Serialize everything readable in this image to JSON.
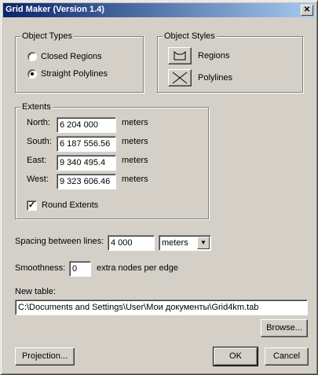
{
  "window": {
    "title": "Grid Maker (Version 1.4)",
    "close_glyph": "✕"
  },
  "object_types": {
    "legend": "Object Types",
    "options": [
      {
        "label": "Closed Regions",
        "selected": false
      },
      {
        "label": "Straight Polylines",
        "selected": true
      }
    ]
  },
  "object_styles": {
    "legend": "Object Styles",
    "regions_label": "Regions",
    "polylines_label": "Polylines"
  },
  "extents": {
    "legend": "Extents",
    "north_label": "North:",
    "north_value": "6 204 000",
    "south_label": "South:",
    "south_value": "6 187 556.56",
    "east_label": "East:",
    "east_value": "9 340 495.4",
    "west_label": "West:",
    "west_value": "9 323 606.46",
    "unit": "meters",
    "round_label": "Round Extents",
    "round_checked": true,
    "check_glyph": "✓"
  },
  "spacing": {
    "label": "Spacing between lines:",
    "value": "4 000",
    "unit_selected": "meters",
    "arrow_glyph": "▼"
  },
  "smoothness": {
    "label": "Smoothness:",
    "value": "0",
    "suffix": "extra nodes per edge"
  },
  "new_table": {
    "label": "New table:",
    "path": "C:\\Documents and Settings\\User\\Мои документы\\Grid4km.tab",
    "browse_label": "Browse..."
  },
  "buttons": {
    "projection": "Projection...",
    "ok": "OK",
    "cancel": "Cancel"
  }
}
